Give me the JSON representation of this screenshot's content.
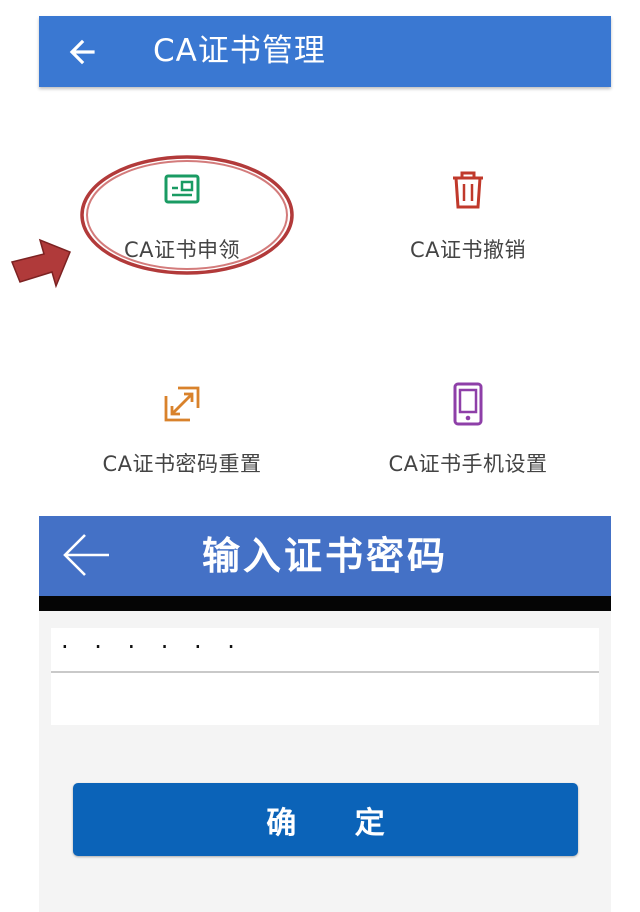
{
  "top_screen": {
    "header": {
      "title": "CA证书管理",
      "back_icon": "arrow-left-icon"
    },
    "tiles": [
      {
        "label": "CA证书申领",
        "icon": "id-card-icon",
        "color": "#1a9b63"
      },
      {
        "label": "CA证书撤销",
        "icon": "trash-icon",
        "color": "#c0392b"
      },
      {
        "label": "CA证书密码重置",
        "icon": "reset-arrows-icon",
        "color": "#d9822b"
      },
      {
        "label": "CA证书手机设置",
        "icon": "phone-icon",
        "color": "#8e3fa8"
      }
    ],
    "annotation": {
      "highlight_color": "#b23a3a",
      "arrow_color": "#b03a3a"
    }
  },
  "bottom_screen": {
    "header": {
      "title": "输入证书密码",
      "back_icon": "arrow-left-icon"
    },
    "password_field": {
      "value": "· · · · · ·"
    },
    "confirm_button": {
      "label": "确 定"
    },
    "colors": {
      "header": "#4471c6",
      "button": "#0b63b8"
    }
  }
}
